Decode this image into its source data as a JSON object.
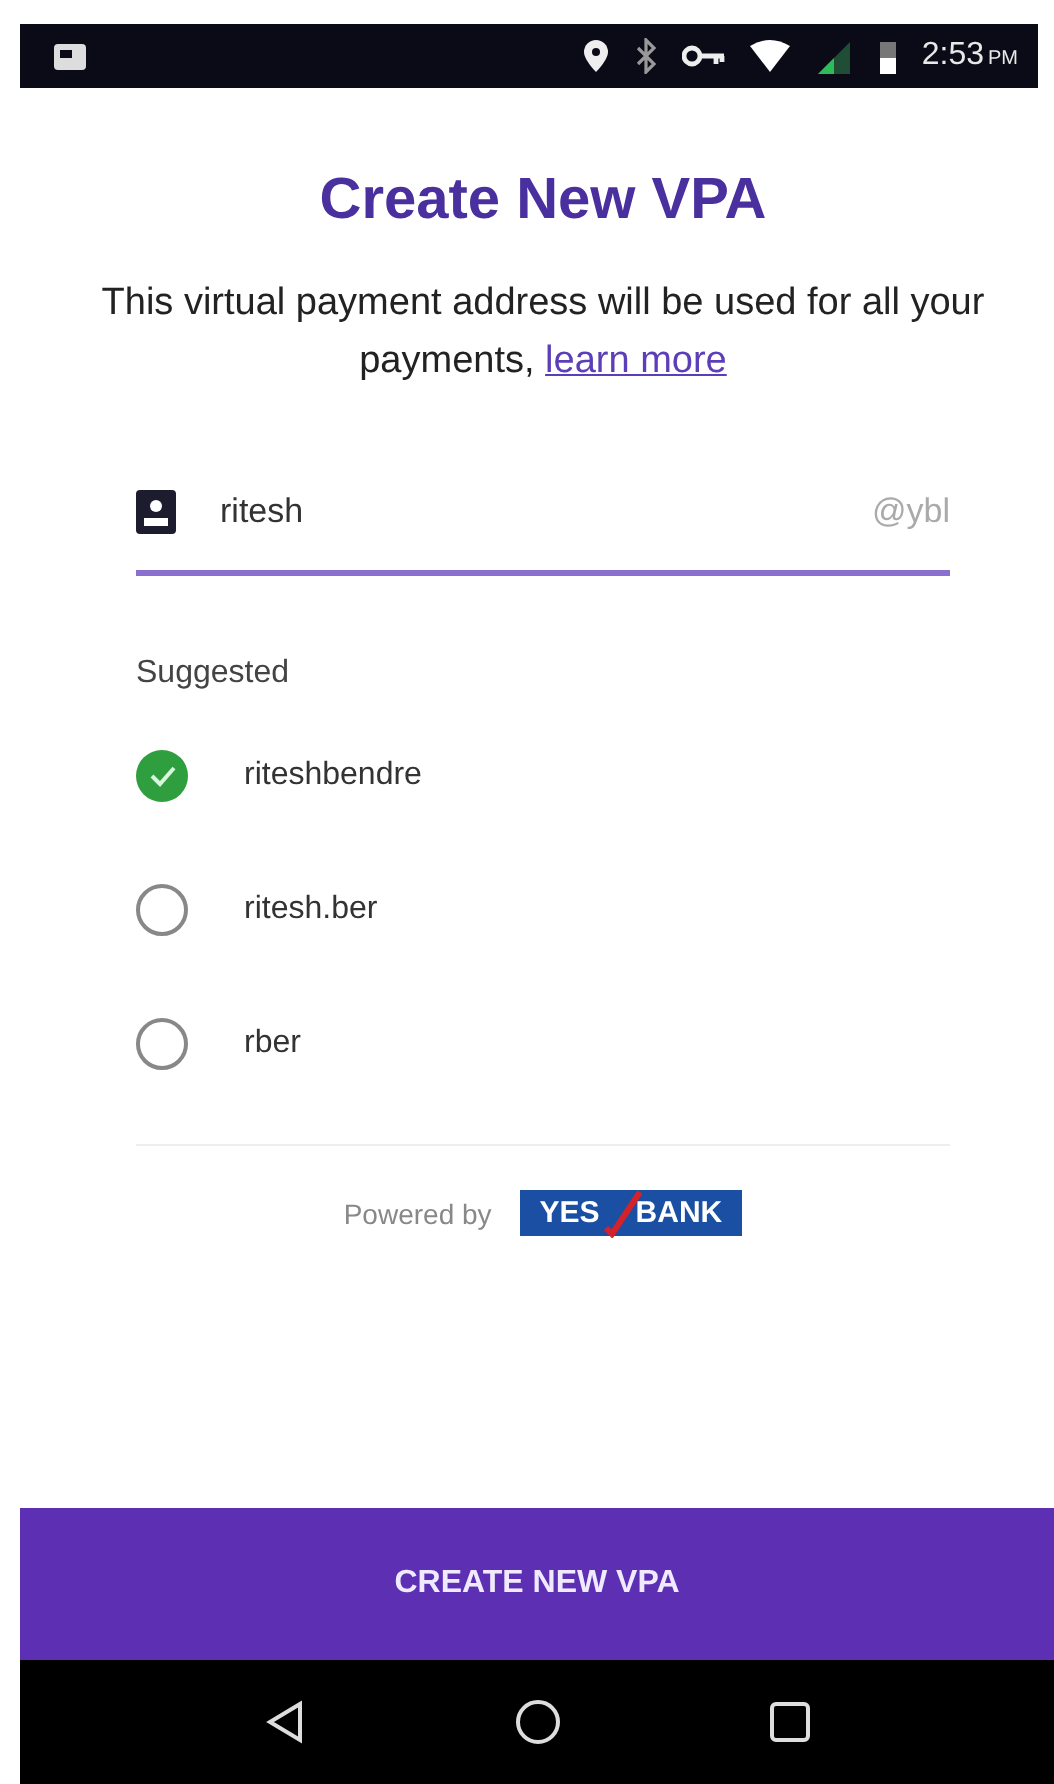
{
  "status_bar": {
    "time": "2:53",
    "meridiem": "PM"
  },
  "header": {
    "title": "Create New VPA",
    "subtitle": "This virtual payment address will be used for all your payments,",
    "link": "learn more"
  },
  "vpa_field": {
    "value": "ritesh",
    "suffix": "@ybl"
  },
  "suggested": {
    "label": "Suggested",
    "options": [
      {
        "label": "riteshbendre",
        "selected": true
      },
      {
        "label": "ritesh.ber",
        "selected": false
      },
      {
        "label": "rber",
        "selected": false
      }
    ]
  },
  "powered_by": {
    "label": "Powered by",
    "logo_left": "YES",
    "logo_right": "BANK"
  },
  "primary_button": "CREATE NEW VPA"
}
